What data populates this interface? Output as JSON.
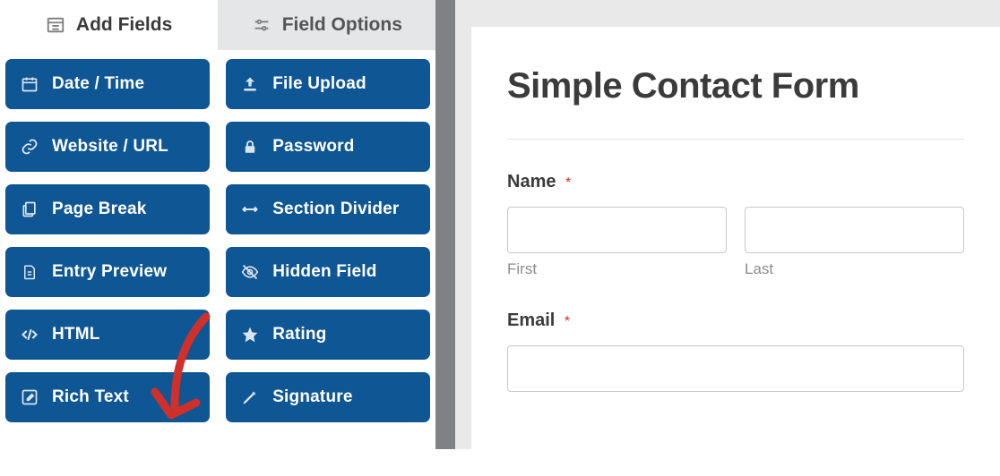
{
  "tabs": {
    "add_fields": "Add Fields",
    "field_options": "Field Options"
  },
  "fields": {
    "date_time": "Date / Time",
    "file_upload": "File Upload",
    "website_url": "Website / URL",
    "password": "Password",
    "page_break": "Page Break",
    "section_divider": "Section Divider",
    "entry_preview": "Entry Preview",
    "hidden_field": "Hidden Field",
    "html": "HTML",
    "rating": "Rating",
    "rich_text": "Rich Text",
    "signature": "Signature"
  },
  "form": {
    "title": "Simple Contact Form",
    "name_label": "Name",
    "first_sub": "First",
    "last_sub": "Last",
    "email_label": "Email",
    "required_mark": "*"
  },
  "colors": {
    "field_btn": "#0f5694",
    "annotation": "#d1302a"
  }
}
